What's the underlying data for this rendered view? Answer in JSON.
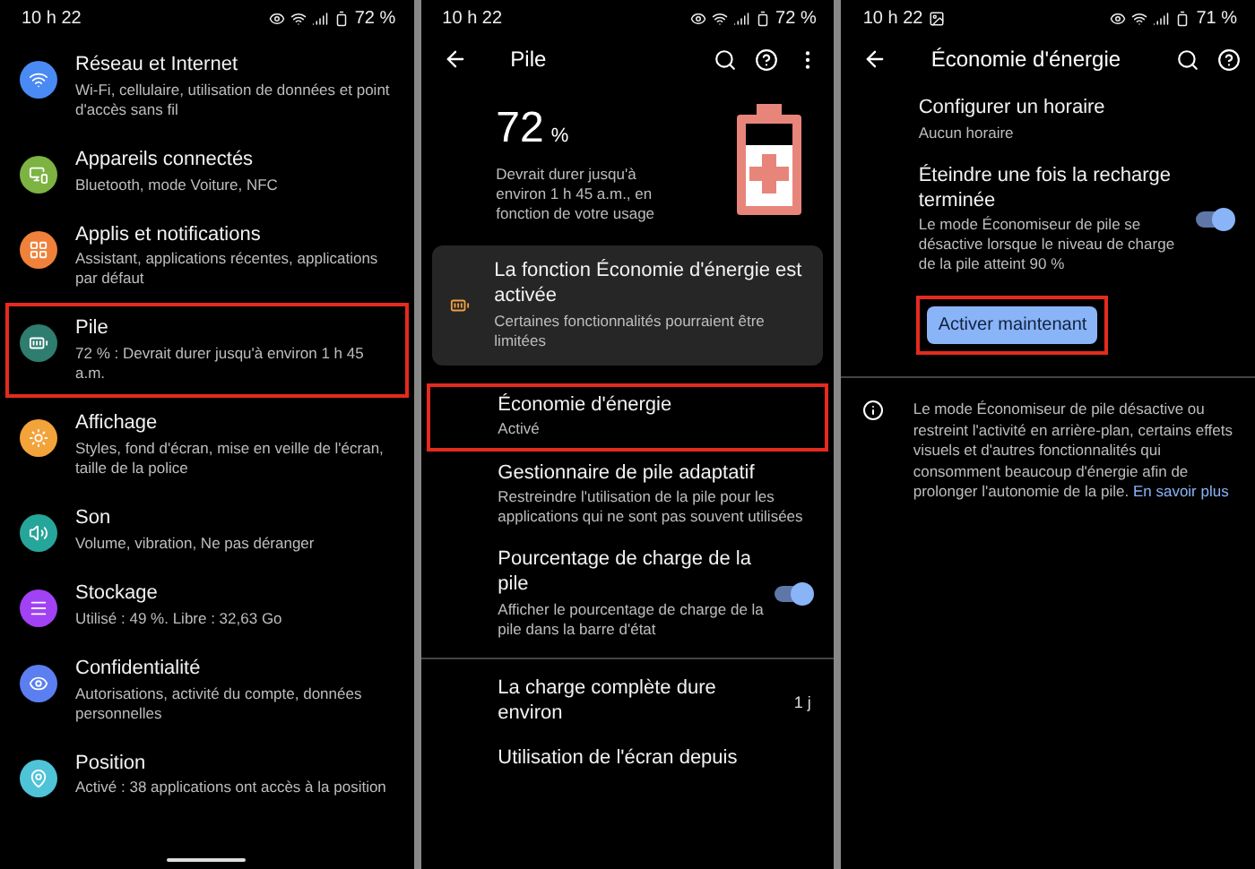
{
  "screens": [
    {
      "status": {
        "time": "10 h 22",
        "battery": "72 %"
      },
      "items": [
        {
          "title": "Réseau et Internet",
          "subtitle": "Wi-Fi, cellulaire, utilisation de données et point d'accès sans fil",
          "color": "#4a8af4",
          "highlighted": false
        },
        {
          "title": "Appareils connectés",
          "subtitle": "Bluetooth, mode Voiture, NFC",
          "color": "#7cb342",
          "highlighted": false
        },
        {
          "title": "Applis et notifications",
          "subtitle": "Assistant, applications récentes, applications par défaut",
          "color": "#f0813a",
          "highlighted": false
        },
        {
          "title": "Pile",
          "subtitle": "72 % : Devrait durer jusqu'à environ 1 h 45 a.m.",
          "color": "#2e7d6e",
          "highlighted": true
        },
        {
          "title": "Affichage",
          "subtitle": "Styles, fond d'écran, mise en veille de l'écran, taille de la police",
          "color": "#f2a33a",
          "highlighted": false
        },
        {
          "title": "Son",
          "subtitle": "Volume, vibration, Ne pas déranger",
          "color": "#26a69a",
          "highlighted": false
        },
        {
          "title": "Stockage",
          "subtitle": "Utilisé : 49 %. Libre : 32,63 Go",
          "color": "#a142f4",
          "highlighted": false
        },
        {
          "title": "Confidentialité",
          "subtitle": "Autorisations, activité du compte, données personnelles",
          "color": "#5b7ff0",
          "highlighted": false
        },
        {
          "title": "Position",
          "subtitle": "Activé : 38 applications ont accès à la position",
          "color": "#4fc3d7",
          "highlighted": false
        }
      ]
    },
    {
      "status": {
        "time": "10 h 22",
        "battery": "72 %"
      },
      "toolbar": {
        "title": "Pile",
        "actions": [
          {
            "kind": "search"
          },
          {
            "kind": "help"
          },
          {
            "kind": "more"
          }
        ]
      },
      "hero": {
        "percent": "72",
        "unit": "%",
        "estimate": "Devrait durer jusqu'à environ 1 h 45 a.m., en fonction de votre usage"
      },
      "card": {
        "title": "La fonction Économie d'énergie est activée",
        "subtitle": "Certaines fonctionnalités pourraient être limitées"
      },
      "rows": [
        {
          "kind": "plain",
          "title": "Économie d'énergie",
          "subtitle": "Activé",
          "highlighted": true
        },
        {
          "kind": "plain",
          "title": "Gestionnaire de pile adaptatif",
          "subtitle": "Restreindre l'utilisation de la pile pour les applications qui ne sont pas souvent utilisées",
          "highlighted": false
        },
        {
          "kind": "toggle",
          "title": "Pourcentage de charge de la pile",
          "subtitle": "Afficher le pourcentage de charge de la pile dans la barre d'état",
          "on": true,
          "highlighted": false
        },
        {
          "kind": "divider"
        },
        {
          "kind": "value",
          "title": "La charge complète dure environ",
          "value": "1 j",
          "highlighted": false
        },
        {
          "kind": "plain",
          "title": "Utilisation de l'écran depuis",
          "highlighted": false
        }
      ]
    },
    {
      "status": {
        "time": "10 h 22",
        "battery": "71 %",
        "extra_icons": [
          {
            "kind": "image"
          }
        ]
      },
      "toolbar": {
        "title": "Économie d'énergie",
        "actions": [
          {
            "kind": "search"
          },
          {
            "kind": "help"
          }
        ]
      },
      "rows": [
        {
          "kind": "plain",
          "title": "Configurer un horaire",
          "subtitle": "Aucun horaire",
          "highlighted": false
        },
        {
          "kind": "toggle",
          "title": "Éteindre une fois la recharge terminée",
          "subtitle": "Le mode Économiseur de pile se désactive lorsque le niveau de charge de la pile atteint 90 %",
          "on": true,
          "highlighted": false
        }
      ],
      "button": {
        "label": "Activer maintenant",
        "highlighted": true
      },
      "info": {
        "text": "Le mode Économiseur de pile désactive ou restreint l'activité en arrière-plan, certains effets visuels et d'autres fonctionnalités qui consomment beaucoup d'énergie afin de prolonger l'autonomie de la pile.",
        "link": "En savoir plus"
      }
    }
  ]
}
